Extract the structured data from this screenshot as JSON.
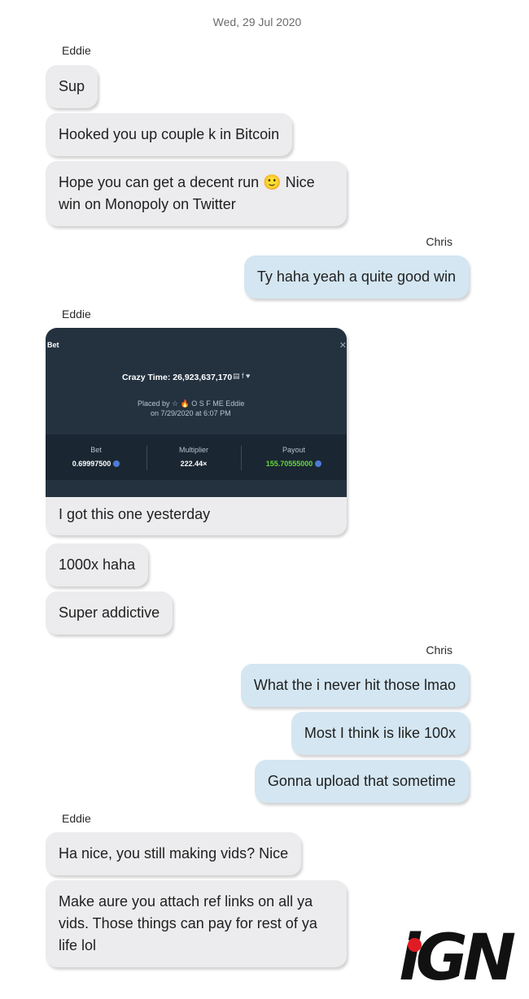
{
  "date_divider": "Wed, 29 Jul 2020",
  "participants": {
    "other": "Eddie",
    "self": "Chris"
  },
  "messages": [
    {
      "from": "Eddie",
      "text": "Sup"
    },
    {
      "from": "Eddie",
      "text": "Hooked you up couple k in Bitcoin"
    },
    {
      "from": "Eddie",
      "text": "Hope you can get a decent run 🙂 Nice win on Monopoly on Twitter"
    },
    {
      "from": "Chris",
      "text": "Ty haha yeah a quite good win"
    },
    {
      "from": "Eddie",
      "text": "I got this one yesterday"
    },
    {
      "from": "Eddie",
      "text": "1000x haha"
    },
    {
      "from": "Eddie",
      "text": "Super addictive"
    },
    {
      "from": "Chris",
      "text": "What the i never hit those lmao"
    },
    {
      "from": "Chris",
      "text": "Most I think is like 100x"
    },
    {
      "from": "Chris",
      "text": "Gonna upload that sometime"
    },
    {
      "from": "Eddie",
      "text": "Ha nice, you still making vids? Nice"
    },
    {
      "from": "Eddie",
      "text": "Make aure you attach ref links on all ya vids. Those things can pay for rest of ya life lol"
    }
  ],
  "bet_screenshot": {
    "title": "Bet",
    "close_glyph": "✕",
    "headline": "Crazy Time: 26,923,637,170",
    "headline_icons": "▤ f ♥",
    "placed_by": "Placed by ☆ 🔥 O S F ME Eddie",
    "placed_on": "on 7/29/2020 at 6:07 PM",
    "stats": [
      {
        "label": "Bet",
        "value": "0.69997500",
        "coin": true,
        "color": "#ffffff"
      },
      {
        "label": "Multiplier",
        "value": "222.44×",
        "coin": false,
        "color": "#ffffff"
      },
      {
        "label": "Payout",
        "value": "155.70555000",
        "coin": true,
        "color": "#62d93a"
      }
    ]
  },
  "watermark": {
    "text": "iGN",
    "accent": "#e01b24"
  },
  "colors": {
    "incoming_bubble": "#ececee",
    "outgoing_bubble": "#d4e6f1",
    "screenshot_bg": "#243240"
  }
}
